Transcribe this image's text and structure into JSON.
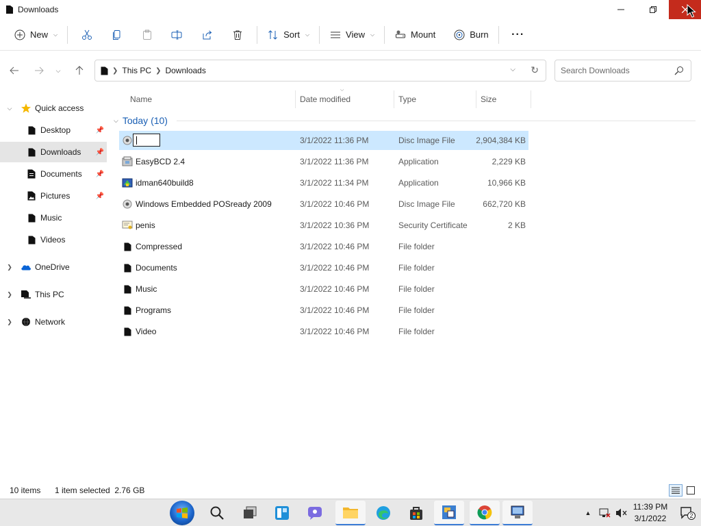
{
  "window": {
    "title": "Downloads"
  },
  "toolbar": {
    "new_label": "New",
    "sort_label": "Sort",
    "view_label": "View",
    "mount_label": "Mount",
    "burn_label": "Burn",
    "more_label": "···"
  },
  "address": {
    "crumbs": [
      "This PC",
      "Downloads"
    ]
  },
  "search": {
    "placeholder": "Search Downloads"
  },
  "nav": {
    "quick_access": "Quick access",
    "desktop": "Desktop",
    "downloads": "Downloads",
    "documents": "Documents",
    "pictures": "Pictures",
    "music": "Music",
    "videos": "Videos",
    "onedrive": "OneDrive",
    "this_pc": "This PC",
    "network": "Network"
  },
  "columns": {
    "name": "Name",
    "date": "Date modified",
    "type": "Type",
    "size": "Size"
  },
  "group": {
    "label": "Today (10)"
  },
  "files": [
    {
      "name": "",
      "date": "3/1/2022 11:36 PM",
      "type": "Disc Image File",
      "size": "2,904,384 KB",
      "icon": "disc-image-icon"
    },
    {
      "name": "EasyBCD 2.4",
      "date": "3/1/2022 11:36 PM",
      "type": "Application",
      "size": "2,229 KB",
      "icon": "installer-icon"
    },
    {
      "name": "idman640build8",
      "date": "3/1/2022 11:34 PM",
      "type": "Application",
      "size": "10,966 KB",
      "icon": "installer-icon"
    },
    {
      "name": "Windows Embedded POSready 2009",
      "date": "3/1/2022 10:46 PM",
      "type": "Disc Image File",
      "size": "662,720 KB",
      "icon": "disc-image-icon"
    },
    {
      "name": "penis",
      "date": "3/1/2022 10:36 PM",
      "type": "Security Certificate",
      "size": "2 KB",
      "icon": "certificate-icon"
    },
    {
      "name": "Compressed",
      "date": "3/1/2022 10:46 PM",
      "type": "File folder",
      "size": "",
      "icon": "folder-icon"
    },
    {
      "name": "Documents",
      "date": "3/1/2022 10:46 PM",
      "type": "File folder",
      "size": "",
      "icon": "folder-icon"
    },
    {
      "name": "Music",
      "date": "3/1/2022 10:46 PM",
      "type": "File folder",
      "size": "",
      "icon": "folder-icon"
    },
    {
      "name": "Programs",
      "date": "3/1/2022 10:46 PM",
      "type": "File folder",
      "size": "",
      "icon": "folder-icon"
    },
    {
      "name": "Video",
      "date": "3/1/2022 10:46 PM",
      "type": "File folder",
      "size": "",
      "icon": "folder-icon"
    }
  ],
  "status": {
    "count": "10 items",
    "selection": "1 item selected  2.76 GB"
  },
  "clock": {
    "time": "11:39 PM",
    "date": "3/1/2022"
  },
  "notifications": {
    "count": "2"
  },
  "colors": {
    "accent": "#0067c0",
    "selection": "#cce8ff",
    "close": "#c42b1c",
    "group_text": "#1a5fb4"
  }
}
